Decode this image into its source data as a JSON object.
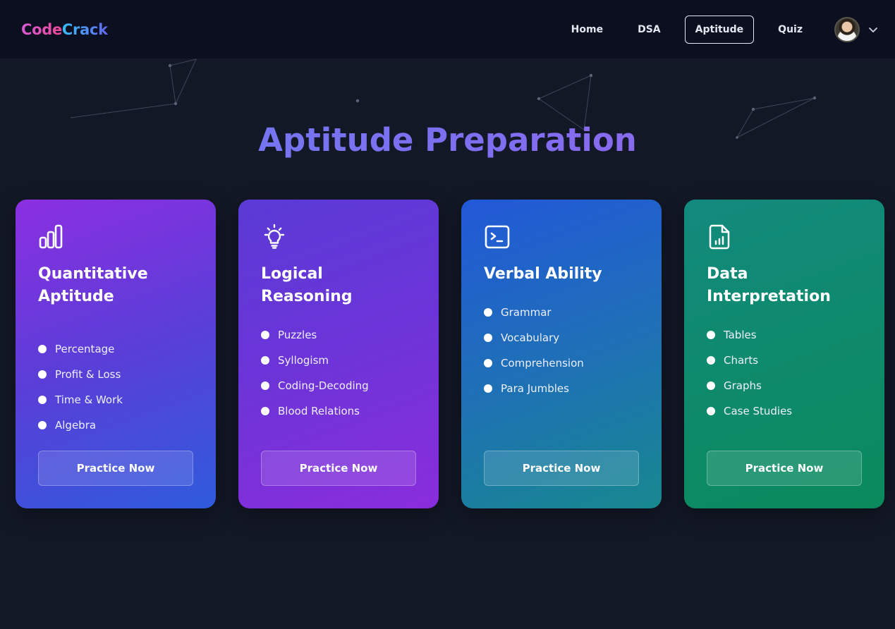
{
  "brand": {
    "part1": "Code",
    "part2": "Crack"
  },
  "nav": {
    "items": [
      {
        "label": "Home",
        "active": false
      },
      {
        "label": "DSA",
        "active": false
      },
      {
        "label": "Aptitude",
        "active": true
      },
      {
        "label": "Quiz",
        "active": false
      }
    ]
  },
  "page": {
    "title": "Aptitude Preparation"
  },
  "cards": [
    {
      "icon": "bar-chart-icon",
      "title_line1": "Quantitative",
      "title_line2": "Aptitude",
      "topics": [
        "Percentage",
        "Profit & Loss",
        "Time & Work",
        "Algebra"
      ],
      "button": "Practice Now",
      "colors": [
        "#8b2fe0",
        "#2f5bdc"
      ]
    },
    {
      "icon": "lightbulb-icon",
      "title_line1": "Logical Reasoning",
      "title_line2": "",
      "topics": [
        "Puzzles",
        "Syllogism",
        "Coding-Decoding",
        "Blood Relations"
      ],
      "button": "Practice Now",
      "colors": [
        "#5a3ad6",
        "#8a2ddc"
      ]
    },
    {
      "icon": "terminal-icon",
      "title_line1": "Verbal Ability",
      "title_line2": "",
      "topics": [
        "Grammar",
        "Vocabulary",
        "Comprehension",
        "Para Jumbles"
      ],
      "button": "Practice Now",
      "colors": [
        "#2258d8",
        "#17888f"
      ]
    },
    {
      "icon": "file-chart-icon",
      "title_line1": "Data Interpretation",
      "title_line2": "",
      "topics": [
        "Tables",
        "Charts",
        "Graphs",
        "Case Studies"
      ],
      "button": "Practice Now",
      "colors": [
        "#128a7e",
        "#0a8a5c"
      ]
    }
  ]
}
